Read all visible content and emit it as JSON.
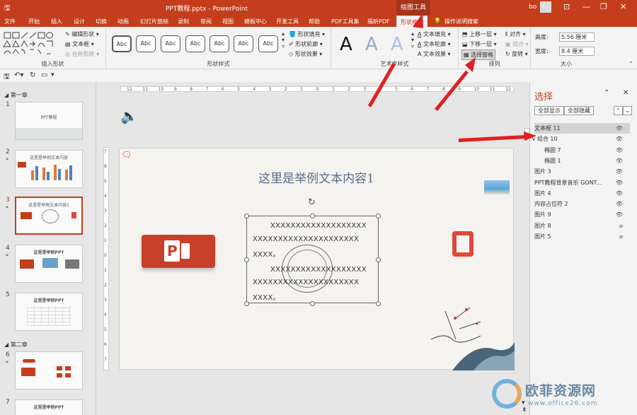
{
  "titlebar": {
    "title": "PPT教程.pptx  -  PowerPoint",
    "context_tab": "绘图工具",
    "user": "bo",
    "minimize": "—",
    "restore": "❐",
    "close": "✕"
  },
  "menu": [
    "文件",
    "开始",
    "插入",
    "设计",
    "切换",
    "动画",
    "幻灯片放映",
    "录制",
    "审阅",
    "视图",
    "模板中心",
    "开发工具",
    "帮助",
    "PDF工具集",
    "福昕PDF",
    "形状格式",
    "操作说明搜索"
  ],
  "ribbon": {
    "insert_shapes": {
      "label": "插入形状",
      "edit_shape": "编辑形状",
      "text_box": "文本框",
      "merge_shapes": "合并形状"
    },
    "shape_styles": {
      "label": "形状样式",
      "abc": "Abc",
      "fill": "形状填充",
      "outline": "形状轮廓",
      "effects": "形状效果"
    },
    "art_styles": {
      "label": "艺术字样式",
      "A": "A",
      "text_fill": "文本填充",
      "text_outline": "文本轮廓",
      "text_effects": "文本效果"
    },
    "arrange": {
      "label": "排列",
      "bring_forward": "上移一层",
      "send_backward": "下移一层",
      "selection_pane": "选择窗格",
      "align": "对齐",
      "group": "组合",
      "rotate": "旋转"
    },
    "size": {
      "label": "大小",
      "height_label": "高度:",
      "height_value": "5.56 厘米",
      "width_label": "宽度:",
      "width_value": "8.4 厘米"
    }
  },
  "thumbs": {
    "section1": "第一章",
    "section2": "第二章",
    "slides": [
      {
        "num": "1",
        "star": "",
        "title": "PPT教程"
      },
      {
        "num": "2",
        "star": "*",
        "title": "这里是举例文本内容"
      },
      {
        "num": "3",
        "star": "*",
        "title": "这里是举例文本内容1"
      },
      {
        "num": "4",
        "star": "*",
        "title": "这里是举例PPT"
      },
      {
        "num": "5",
        "star": "",
        "title": "这里是举例PPT"
      },
      {
        "num": "6",
        "star": "*",
        "title": ""
      },
      {
        "num": "7",
        "star": "",
        "title": "这里是举例PPT"
      }
    ]
  },
  "ruler": {
    "h": [
      "12",
      "11",
      "10",
      "9",
      "8",
      "7",
      "6",
      "5",
      "4",
      "3",
      "2",
      "1",
      "0",
      "1",
      "2",
      "3",
      "4",
      "5",
      "6",
      "7",
      "8",
      "9",
      "10",
      "11",
      "12"
    ],
    "v": [
      "7",
      "6",
      "5",
      "4",
      "3",
      "2",
      "1",
      "0",
      "1",
      "2",
      "3",
      "4",
      "5",
      "6",
      "7"
    ]
  },
  "slide": {
    "title": "这里是举例文本内容1",
    "lines": [
      "XXXXXXXXXXXXXXXXXXX",
      "XXXXXXXXXXXXXXXXXXXXX",
      "XXXX。",
      "XXXXXXXXXXXXXXXXXXX",
      "XXXXXXXXXXXXXXXXXXXXX",
      "XXXX。"
    ]
  },
  "selection_pane": {
    "title": "选择",
    "show_all": "全部显示",
    "hide_all": "全部隐藏",
    "up": "⌃",
    "down": "⌄",
    "close": "✕",
    "items": [
      {
        "label": "文本框 11",
        "indent": 0,
        "expander": "",
        "visible": true,
        "selected": true
      },
      {
        "label": "组合 10",
        "indent": 0,
        "expander": "∨",
        "visible": true,
        "selected": false
      },
      {
        "label": "椭圆 7",
        "indent": 1,
        "expander": "",
        "visible": true,
        "selected": false
      },
      {
        "label": "椭圆 1",
        "indent": 1,
        "expander": "",
        "visible": true,
        "selected": false
      },
      {
        "label": "图片 3",
        "indent": 0,
        "expander": "",
        "visible": true,
        "selected": false
      },
      {
        "label": "PPT教程背景音乐 GONT...",
        "indent": 0,
        "expander": "",
        "visible": true,
        "selected": false
      },
      {
        "label": "图片 4",
        "indent": 0,
        "expander": "",
        "visible": true,
        "selected": false
      },
      {
        "label": "内容占位符 2",
        "indent": 0,
        "expander": "",
        "visible": true,
        "selected": false
      },
      {
        "label": "图片 9",
        "indent": 0,
        "expander": "",
        "visible": true,
        "selected": false
      },
      {
        "label": "图片 8",
        "indent": 0,
        "expander": "",
        "visible": false,
        "selected": false
      },
      {
        "label": "图片 5",
        "indent": 0,
        "expander": "",
        "visible": false,
        "selected": false
      }
    ]
  },
  "watermark": {
    "brand": "欧菲资源网",
    "url": "www.office26.com"
  },
  "colors": {
    "accent": "#c43e1c",
    "arrow": "#e02020"
  }
}
